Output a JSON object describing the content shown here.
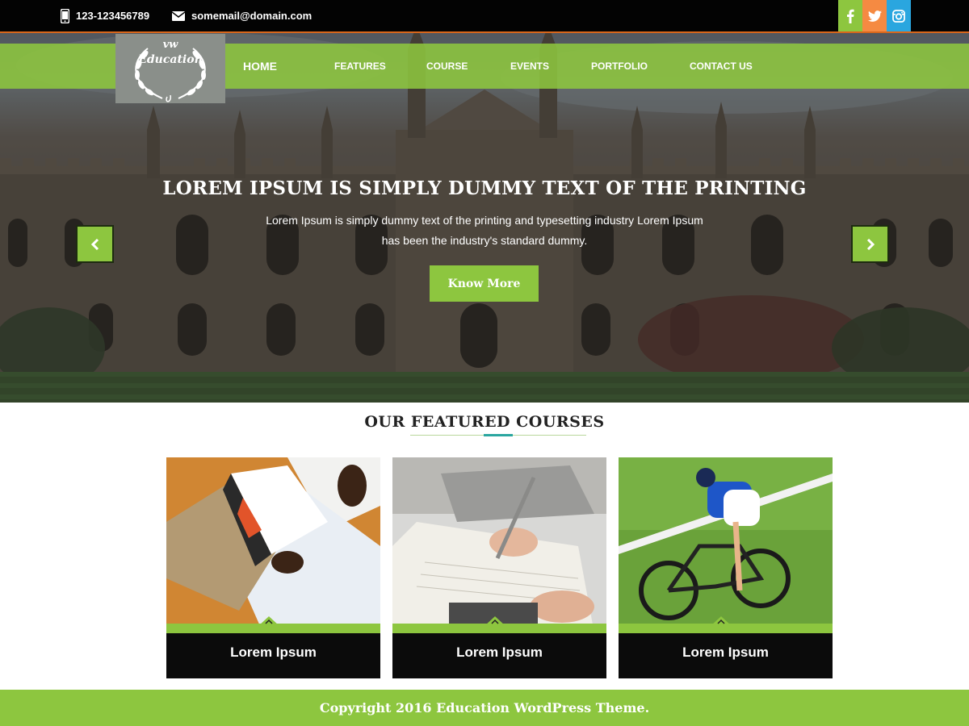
{
  "topbar": {
    "phone": "123-123456789",
    "email": "somemail@domain.com",
    "social": [
      {
        "name": "facebook",
        "glyph": "f",
        "color": "#8dc63f"
      },
      {
        "name": "twitter",
        "glyph": "t",
        "color": "#f58a42"
      },
      {
        "name": "instagram",
        "glyph": "ig",
        "color": "#2aa6df"
      }
    ]
  },
  "logo": {
    "top": "vw",
    "text": "Education"
  },
  "nav": {
    "items": [
      {
        "label": "HOME",
        "active": true
      },
      {
        "label": "FEATURES"
      },
      {
        "label": "COURSE"
      },
      {
        "label": "EVENTS"
      },
      {
        "label": "PORTFOLIO"
      },
      {
        "label": "CONTACT US"
      }
    ]
  },
  "slider": {
    "title": "LOREM IPSUM IS SIMPLY DUMMY TEXT OF THE PRINTING",
    "text": "Lorem Ipsum is simply dummy text of the printing and typesetting industry Lorem Ipsum has been the industry's standard dummy.",
    "button": "Know More",
    "prev_icon": "chevron-left-icon",
    "next_icon": "chevron-right-icon"
  },
  "featured": {
    "title": "OUR FEATURED COURSES",
    "courses": [
      {
        "label": "Lorem Ipsum",
        "image": "student-reading"
      },
      {
        "label": "Lorem Ipsum",
        "image": "writing-notes"
      },
      {
        "label": "Lorem Ipsum",
        "image": "cyclist"
      }
    ]
  },
  "footer": {
    "text": "Copyright 2016 Education WordPress Theme."
  },
  "colors": {
    "accent": "#8dc63f",
    "topbar": "#030303",
    "twitter": "#f58a42",
    "instagram": "#2aa6df"
  }
}
